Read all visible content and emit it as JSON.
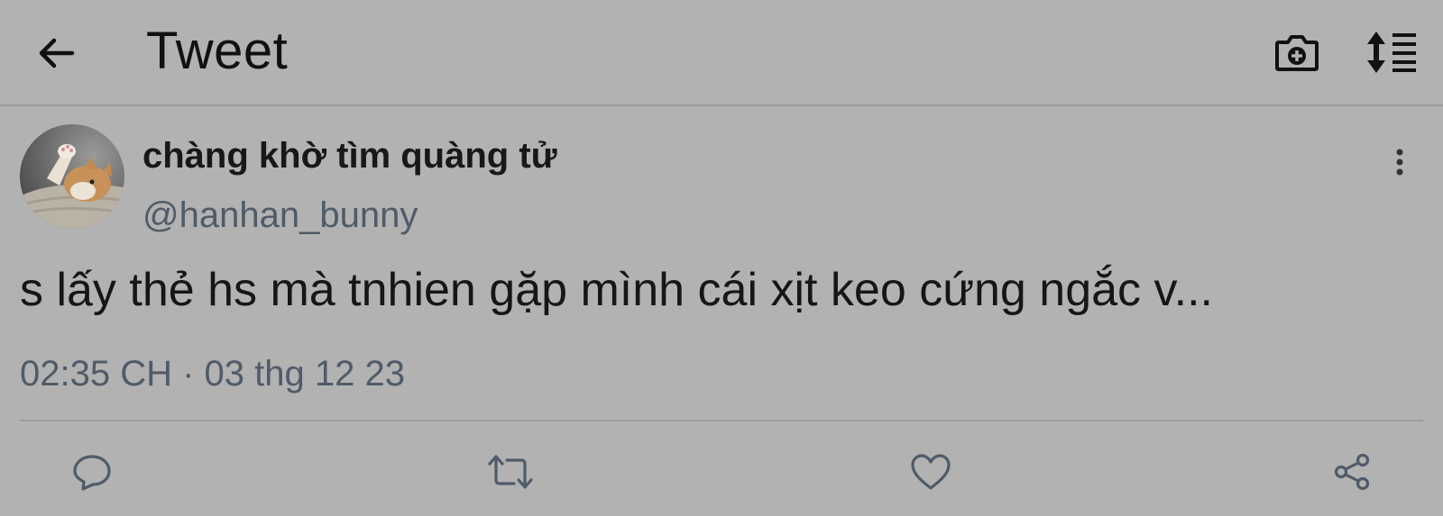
{
  "header": {
    "title": "Tweet",
    "back_icon": "arrow-left-icon",
    "camera_icon": "camera-add-icon",
    "sort_icon": "sort-list-icon"
  },
  "tweet": {
    "author": {
      "display_name": "chàng khờ tìm quàng tử",
      "handle": "@hanhan_bunny",
      "avatar": "cat-photo-avatar"
    },
    "text": "s lấy thẻ hs mà tnhien gặp mình cái xịt keo cứng ngắc v...",
    "timestamp": "02:35 CH · 03 thg 12 23",
    "more_icon": "more-vertical-icon"
  },
  "actions": [
    {
      "icon": "reply-icon"
    },
    {
      "icon": "retweet-icon"
    },
    {
      "icon": "like-heart-icon"
    },
    {
      "icon": "share-icon"
    }
  ],
  "colors": {
    "background": "#b2b2b2",
    "text_primary": "#161616",
    "text_secondary": "#4f5b68",
    "divider": "#9e9e9e"
  }
}
